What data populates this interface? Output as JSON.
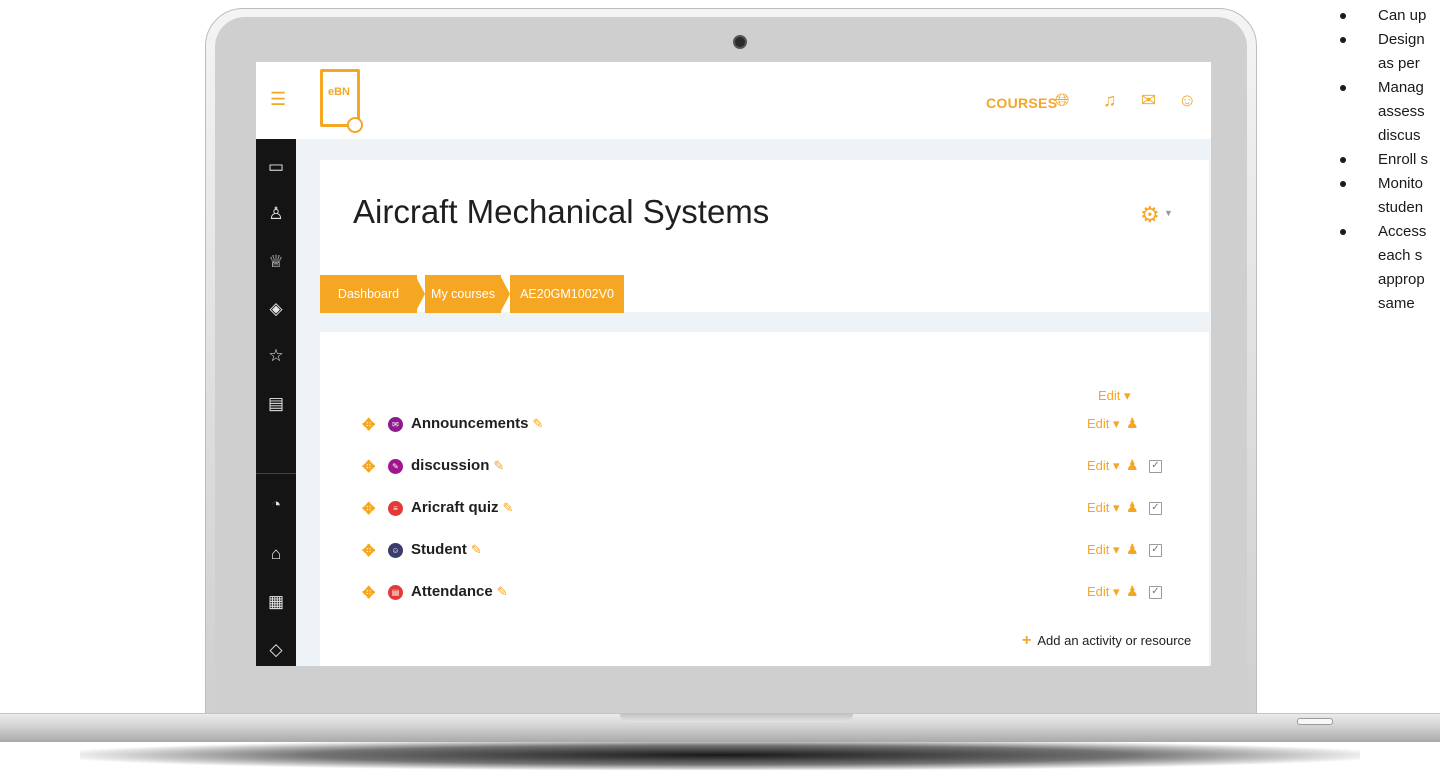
{
  "app": {
    "logo_text": "eBN",
    "nav": {
      "courses_label": "COURSES"
    }
  },
  "sidebar": {
    "icons": [
      "folder-icon",
      "user-badge-icon",
      "award-icon",
      "layers-icon",
      "star-icon",
      "book-icon",
      "dashboard-icon",
      "home-icon",
      "calendar-icon"
    ]
  },
  "course": {
    "title": "Aircraft Mechanical Systems",
    "breadcrumbs": [
      "Dashboard",
      "My courses",
      "AE20GM1002V0"
    ]
  },
  "section": {
    "edit_label": "Edit",
    "activities": [
      {
        "name": "Announcements",
        "edit": "Edit",
        "icon_color": "#8e1a8e",
        "has_check": false
      },
      {
        "name": "discussion",
        "edit": "Edit",
        "icon_color": "#a0168f",
        "has_check": true
      },
      {
        "name": "Aricraft quiz",
        "edit": "Edit",
        "icon_color": "#e53935",
        "has_check": true
      },
      {
        "name": "Student",
        "edit": "Edit",
        "icon_color": "#3b3b6e",
        "has_check": true
      },
      {
        "name": "Attendance",
        "edit": "Edit",
        "icon_color": "#e53935",
        "has_check": true
      }
    ],
    "add_label": "Add an activity or resource"
  },
  "side_text": {
    "bullets": [
      [
        "Can up"
      ],
      [
        "Design",
        "as per"
      ],
      [
        "Manag",
        "assess",
        "discus"
      ],
      [
        "Enroll s"
      ],
      [
        "Monito",
        "studen"
      ],
      [
        "Access",
        "each s",
        "approp",
        "same"
      ]
    ]
  },
  "colors": {
    "accent": "#f5a623",
    "sidebar": "#141414",
    "page_bg": "#eef3f7"
  }
}
